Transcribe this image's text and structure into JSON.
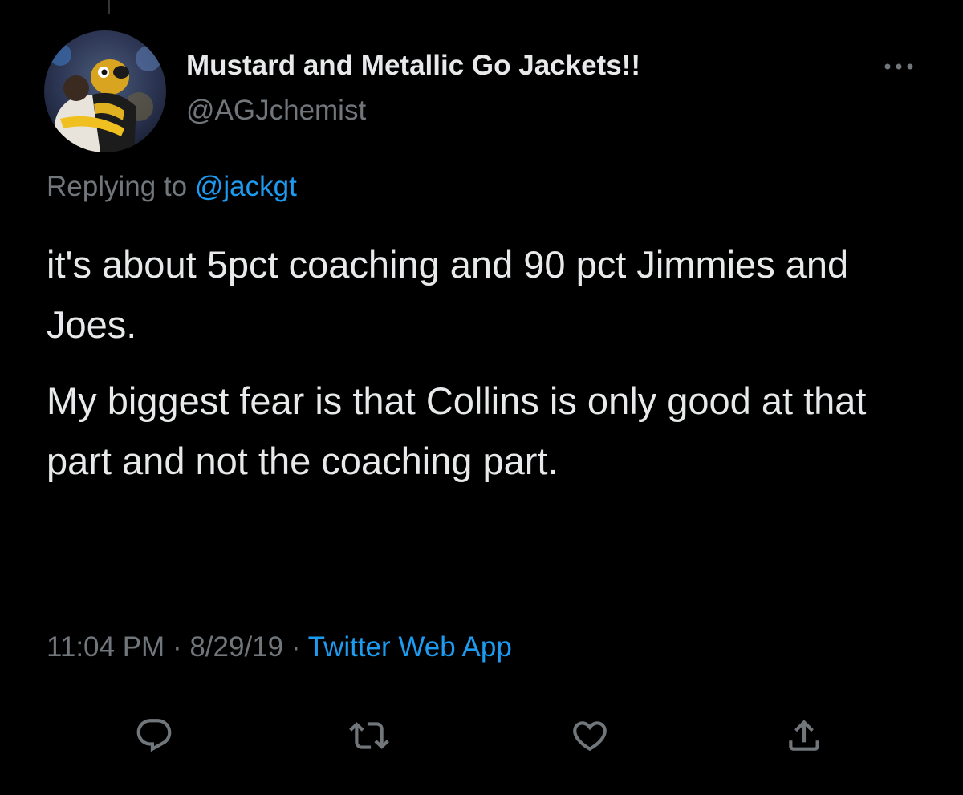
{
  "tweet": {
    "author": {
      "display_name": "Mustard and Metallic Go Jackets!!",
      "handle": "@AGJchemist",
      "avatar_icon": "avatar-photo"
    },
    "reply_context": {
      "prefix": "Replying to",
      "mention": "@jackgt"
    },
    "text_paragraphs": [
      "it's about 5pct coaching and 90 pct Jimmies and Joes.",
      "My biggest fear is that Collins is only good at that part and not the coaching part."
    ],
    "meta": {
      "time": "11:04 PM",
      "separator": "·",
      "date": "8/29/19",
      "source": "Twitter Web App"
    },
    "actions": [
      {
        "name": "reply",
        "icon": "reply-icon"
      },
      {
        "name": "retweet",
        "icon": "retweet-icon"
      },
      {
        "name": "like",
        "icon": "heart-icon"
      },
      {
        "name": "share",
        "icon": "share-icon"
      }
    ]
  },
  "colors": {
    "background": "#000000",
    "text_primary": "#e7e9ea",
    "text_secondary": "#71767b",
    "accent": "#1d9bf0"
  }
}
